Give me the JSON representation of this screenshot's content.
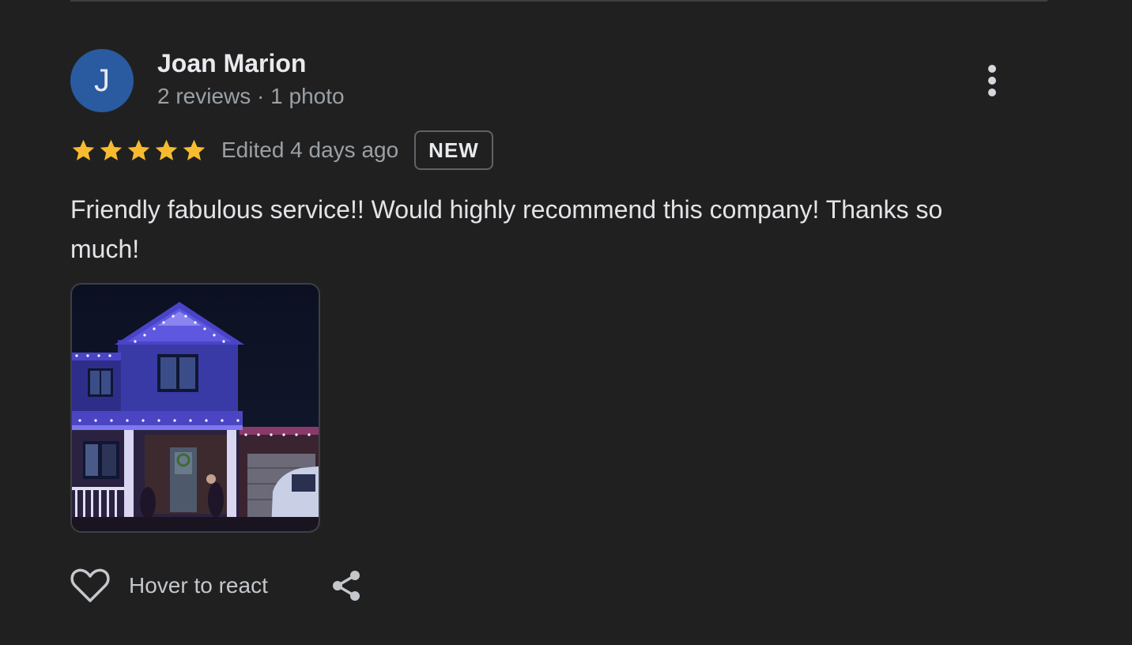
{
  "review": {
    "avatar_initial": "J",
    "avatar_color": "#2a5aa0",
    "reviewer_name": "Joan Marion",
    "reviewer_meta": "2 reviews · 1 photo",
    "rating": 5,
    "rating_max": 5,
    "star_color": "#f6bb2f",
    "edited_label": "Edited 4 days ago",
    "badge": "NEW",
    "text": "Friendly fabulous service!! Would highly recommend this company! Thanks so much!",
    "photo_icon": "house-photo",
    "more_icon": "more-vert-icon"
  },
  "actions": {
    "react_label": "Hover to react",
    "react_icon": "heart-outline-icon",
    "share_icon": "share-icon"
  }
}
